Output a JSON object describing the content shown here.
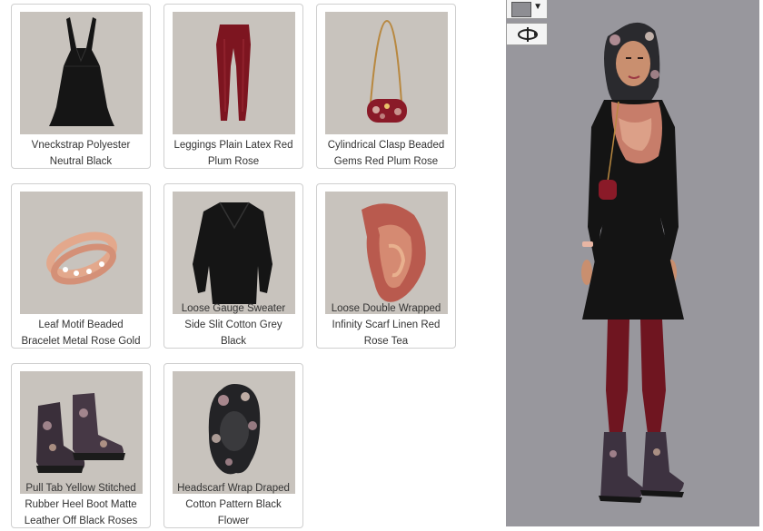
{
  "items": [
    {
      "name": "Vneckstrap Polyester Neutral Black",
      "line1": "Vneckstrap Polyester",
      "line2": "Neutral Black",
      "icon": "dress-icon"
    },
    {
      "name": "Leggings Plain Latex Red Plum Rose",
      "line1": "Leggings Plain Latex Red",
      "line2": "Plum Rose",
      "icon": "leggings-icon"
    },
    {
      "name": "Cylindrical Clasp Beaded Gems Red Plum Rose",
      "line1": "Cylindrical Clasp Beaded",
      "line2": "Gems Red Plum Rose",
      "icon": "handbag-icon"
    },
    {
      "name": "Leaf Motif Beaded Bracelet Metal Rose Gold",
      "line1": "Leaf Motif Beaded",
      "line2": "Bracelet Metal Rose Gold",
      "icon": "bracelet-icon"
    },
    {
      "name": "Loose Gauge Sweater Side Slit Cotton Grey Black",
      "line1": "Loose Gauge Sweater",
      "line2": "Side Slit Cotton Grey",
      "line3": "Black",
      "icon": "sweater-icon"
    },
    {
      "name": "Loose Double Wrapped Infinity Scarf Linen Red Rose Tea",
      "line1": "Loose Double Wrapped",
      "line2": "Infinity Scarf Linen Red",
      "line3": "Rose Tea",
      "icon": "scarf-icon"
    },
    {
      "name": "Pull Tab Yellow Stitched Rubber Heel Boot Matte Leather Off Black Roses",
      "line1": "Pull Tab Yellow Stitched",
      "line2": "Rubber Heel Boot Matte",
      "line3": "Leather Off Black Roses",
      "icon": "boots-icon"
    },
    {
      "name": "Headscarf Wrap Draped Cotton Pattern Black Flower",
      "line1": "Headscarf Wrap Draped",
      "line2": "Cotton Pattern Black",
      "line3": "Flower",
      "icon": "headscarf-icon"
    }
  ],
  "controls": {
    "background_color": "#8e8e93",
    "color_icon": "color-swatch-icon",
    "dropdown_icon": "chevron-down-icon",
    "rotate_icon": "rotate-icon"
  },
  "colors": {
    "thumb_bg": "#c8c3bd",
    "avatar_bg": "#98979d",
    "card_border": "#cfcfcf"
  }
}
